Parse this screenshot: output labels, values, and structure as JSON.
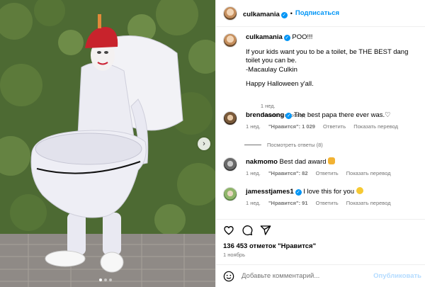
{
  "post": {
    "username": "culkamania",
    "follow_label": "Подписаться",
    "caption_lines": [
      "POO!!!",
      "",
      "If your kids want you to be a toilet, be THE BEST dang toilet you can be.",
      "-Macaulay Culkin",
      "",
      "Happy Halloween y'all."
    ],
    "caption_time": "1 нед.",
    "translate_label": "Показать перевод"
  },
  "comments": [
    {
      "username": "brendasong",
      "text": "The best papa there ever was.♡",
      "time": "1 нед.",
      "likes": "\"Нравится\": 1 029",
      "reply_label": "Ответить",
      "translate_label": "Показать перевод"
    },
    {
      "username": "nakmomo",
      "text": "Best dad award",
      "time": "1 нед.",
      "likes": "\"Нравится\": 82",
      "reply_label": "Ответить",
      "translate_label": "Показать перевод"
    },
    {
      "username": "jamesstjames1",
      "text": "I love this for you",
      "time": "1 нед.",
      "likes": "\"Нравится\": 91",
      "reply_label": "Ответить",
      "translate_label": "Показать перевод"
    }
  ],
  "more_replies": "Посмотреть ответы (8)",
  "likes_total": "136 453 отметок \"Нравится\"",
  "post_date": "1 ноябрь",
  "add_comment": {
    "placeholder": "Добавьте комментарий...",
    "publish_label": "Опубликовать"
  },
  "carousel": {
    "slides": 3,
    "active_index": 0
  },
  "colors": {
    "accent": "#0095f6",
    "muted": "#737373",
    "publish_disabled": "#b3dbff"
  },
  "icons": [
    "heart-icon",
    "comment-icon",
    "share-icon",
    "smile-icon",
    "chevron-right-icon",
    "verified-icon"
  ]
}
